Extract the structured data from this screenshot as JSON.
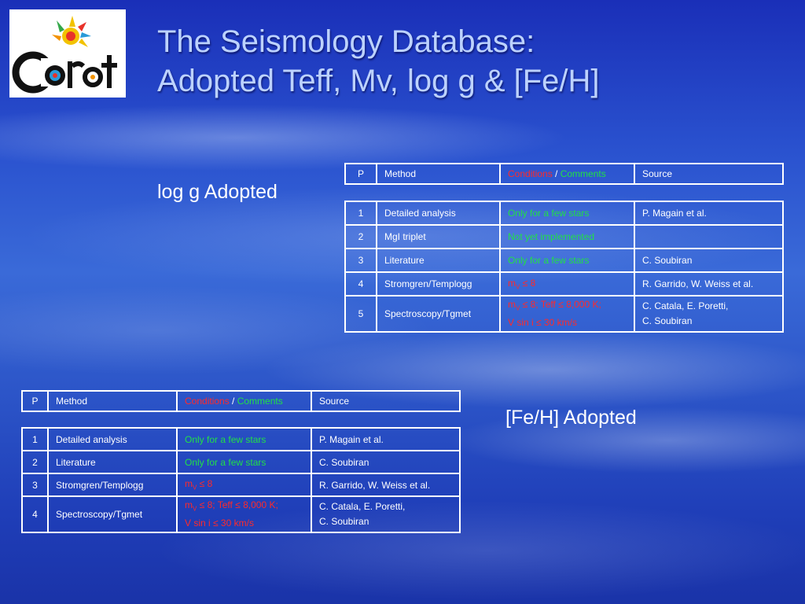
{
  "title": {
    "line1": "The Seismology Database:",
    "line2": "Adopted Teff, Mv, log g & [Fe/H]"
  },
  "logo": {
    "icon": "corot-logo",
    "text": "Corot"
  },
  "colors": {
    "green": "#21e046",
    "red": "#ff2a2a",
    "title": "#bcd2ff"
  },
  "logg": {
    "label": "log g Adopted",
    "header": {
      "p": "P",
      "method": "Method",
      "conditions": "Conditions",
      "sep": " / ",
      "comments": "Comments",
      "source": "Source"
    },
    "rows": [
      {
        "p": "1",
        "method": "Detailed analysis",
        "cond": "Only for a few stars",
        "source": "P. Magain et al."
      },
      {
        "p": "2",
        "method": "MgI triplet",
        "cond": "Not yet implemented",
        "source": ""
      },
      {
        "p": "3",
        "method": "Literature",
        "cond": "Only for a few stars",
        "source": "C. Soubiran"
      },
      {
        "p": "4",
        "method": "Stromgren/Templogg",
        "cond_m": "m",
        "cond_sub": "V",
        "cond_rest": " ≤ 8",
        "source": "R. Garrido, W. Weiss et al."
      },
      {
        "p": "5",
        "method": "Spectroscopy/Tgmet",
        "cond_m": "m",
        "cond_sub": "V",
        "cond_rest": " ≤ 8; Teff ≤ 8,000 K;",
        "cond_line2": "V sin i ≤ 30 km/s",
        "source": "C. Catala, E. Poretti,",
        "source_line2": "C. Soubiran"
      }
    ]
  },
  "feh": {
    "label": "[Fe/H] Adopted",
    "header": {
      "p": "P",
      "method": "Method",
      "conditions": "Conditions",
      "sep": " / ",
      "comments": "Comments",
      "source": "Source"
    },
    "rows": [
      {
        "p": "1",
        "method": "Detailed analysis",
        "cond": "Only for a few stars",
        "source": "P. Magain et al."
      },
      {
        "p": "2",
        "method": "Literature",
        "cond": "Only for a few stars",
        "source": "C. Soubiran"
      },
      {
        "p": "3",
        "method": "Stromgren/Templogg",
        "cond_m": "m",
        "cond_sub": "V",
        "cond_rest": " ≤ 8",
        "source": "R. Garrido, W. Weiss et al."
      },
      {
        "p": "4",
        "method": "Spectroscopy/Tgmet",
        "cond_m": "m",
        "cond_sub": "V",
        "cond_rest": " ≤ 8; Teff ≤ 8,000 K;",
        "cond_line2": "V sin i ≤ 30 km/s",
        "source": "C. Catala, E. Poretti,",
        "source_line2": "C. Soubiran"
      }
    ]
  }
}
